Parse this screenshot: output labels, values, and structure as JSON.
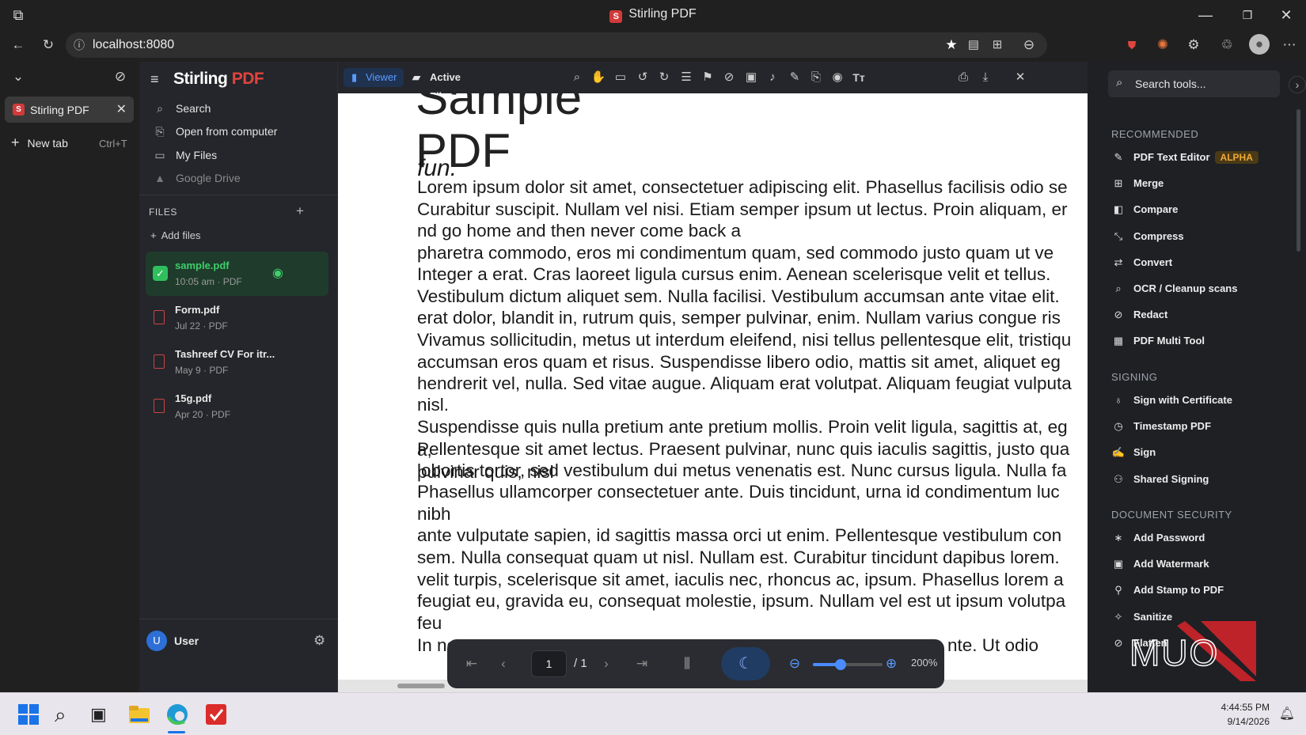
{
  "window": {
    "title": "Stirling PDF"
  },
  "browser": {
    "url": "localhost:8080",
    "tabs": [
      {
        "label": "Stirling PDF"
      }
    ],
    "new_tab": {
      "label": "New tab",
      "shortcut": "Ctrl+T"
    }
  },
  "app": {
    "brand": {
      "name": "Stirling",
      "suffix": "PDF"
    },
    "nav": [
      {
        "label": "Search",
        "icon": "search-icon"
      },
      {
        "label": "Open from computer",
        "icon": "upload-file-icon"
      },
      {
        "label": "My Files",
        "icon": "folder-icon"
      },
      {
        "label": "Google Drive",
        "icon": "google-drive-icon"
      }
    ],
    "files_header": "FILES",
    "add_files": "Add files",
    "files": [
      {
        "name": "sample.pdf",
        "meta": "10:05 am · PDF",
        "selected": true
      },
      {
        "name": "Form.pdf",
        "meta": "Jul 22 · PDF",
        "selected": false
      },
      {
        "name": "Tashreef CV For itr...",
        "meta": "May 9 · PDF",
        "selected": false
      },
      {
        "name": "15g.pdf",
        "meta": "Apr 20 · PDF",
        "selected": false
      }
    ],
    "user": {
      "initial": "U",
      "name": "User"
    }
  },
  "viewer": {
    "tabs": [
      {
        "label": "Viewer",
        "active": true
      },
      {
        "label": "Active Files",
        "active": false
      }
    ],
    "document": {
      "title_top": "Sample",
      "title_pdf": "PDF",
      "tagline": "fun.",
      "lines": [
        "Lorem ipsum dolor sit amet, consectetuer adipiscing elit. Phasellus facilisis odio se",
        "Curabitur suscipit. Nullam vel nisi. Etiam semper ipsum ut lectus. Proin aliquam, er",
        "nd go home and then never come back a",
        "pharetra commodo, eros mi condimentum quam, sed commodo justo quam ut ve",
        "Integer a erat. Cras laoreet ligula cursus enim. Aenean scelerisque velit et tellus.",
        "Vestibulum dictum aliquet sem. Nulla facilisi. Vestibulum accumsan ante vitae elit.",
        "erat dolor, blandit in, rutrum quis, semper pulvinar, enim. Nullam varius congue ris",
        "Vivamus sollicitudin, metus ut interdum eleifend, nisi tellus pellentesque elit, tristiqu",
        "accumsan eros quam et risus. Suspendisse libero odio, mattis sit amet, aliquet eg",
        "hendrerit vel, nulla. Sed vitae augue. Aliquam erat volutpat. Aliquam feugiat vulputa",
        "nisl.",
        "Suspendisse quis nulla pretium ante pretium mollis. Proin velit ligula, sagittis at, eg",
        "Pellentesque sit amet lectus. Praesent pulvinar, nunc quis iaculis sagittis, justo qua",
        "lobortis tortor, sed vestibulum dui metus venenatis est. Nunc cursus ligula. Nulla fa",
        "Phasellus ullamcorper consectetuer ante. Duis tincidunt, urna id condimentum luc",
        "nibh",
        "ante vulputate sapien, id sagittis massa orci ut enim. Pellentesque vestibulum con",
        "sem. Nulla consequat quam ut nisl. Nullam est. Curabitur tincidunt dapibus lorem.",
        "velit turpis, scelerisque sit amet, iaculis nec, rhoncus ac, ipsum. Phasellus lorem a",
        "feugiat eu, gravida eu, consequat molestie, ipsum. Nullam vel est ut ipsum volutpa",
        "feu",
        "In no"
      ],
      "overlap_fragments": [
        "a,",
        "pulvinar quis, nisl"
      ],
      "tail_fragment": "nte. Ut odio"
    },
    "pager": {
      "current_page": "1",
      "total": "/ 1",
      "zoom": "200%",
      "zoom_level": 0.4
    }
  },
  "tools": {
    "search_placeholder": "Search tools...",
    "sections": [
      {
        "title": "RECOMMENDED",
        "items": [
          {
            "label": "PDF Text Editor",
            "badge": "ALPHA",
            "icon": "edit-icon"
          },
          {
            "label": "Merge",
            "icon": "merge-icon"
          },
          {
            "label": "Compare",
            "icon": "compare-icon"
          },
          {
            "label": "Compress",
            "icon": "compress-icon"
          },
          {
            "label": "Convert",
            "icon": "convert-icon"
          },
          {
            "label": "OCR / Cleanup scans",
            "icon": "ocr-icon"
          },
          {
            "label": "Redact",
            "icon": "redact-icon"
          },
          {
            "label": "PDF Multi Tool",
            "icon": "grid-icon"
          }
        ]
      },
      {
        "title": "SIGNING",
        "items": [
          {
            "label": "Sign with Certificate",
            "icon": "certificate-icon"
          },
          {
            "label": "Timestamp PDF",
            "icon": "clock-icon"
          },
          {
            "label": "Sign",
            "icon": "signature-icon"
          },
          {
            "label": "Shared Signing",
            "icon": "shared-users-icon"
          }
        ]
      },
      {
        "title": "DOCUMENT SECURITY",
        "items": [
          {
            "label": "Add Password",
            "icon": "password-icon"
          },
          {
            "label": "Add Watermark",
            "icon": "watermark-icon"
          },
          {
            "label": "Add Stamp to PDF",
            "icon": "stamp-icon"
          },
          {
            "label": "Sanitize",
            "icon": "sanitize-icon"
          },
          {
            "label": "Flatten",
            "icon": "flatten-icon"
          }
        ]
      }
    ]
  },
  "watermark": {
    "text": "MUO"
  },
  "taskbar": {
    "time": "4:44:55 PM",
    "date": "9/14/2026"
  },
  "colors": {
    "accent": "#4a8cff",
    "brand_red": "#d23a3a",
    "selected_file_bg": "#1f3b2c",
    "selected_file_text": "#3fcf6a",
    "alpha_badge": "#f0a838"
  }
}
